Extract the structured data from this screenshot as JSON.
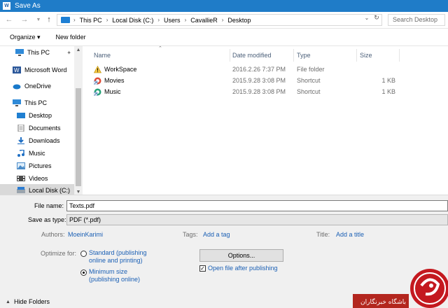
{
  "window": {
    "title": "Save As",
    "app_icon_glyph": "W"
  },
  "address": {
    "crumbs": [
      "This PC",
      "Local Disk (C:)",
      "Users",
      "CavallieR",
      "Desktop"
    ],
    "search_placeholder": "Search Desktop"
  },
  "toolbar": {
    "organize_label": "Organize ▾",
    "new_folder_label": "New folder"
  },
  "sidebar": {
    "items": [
      {
        "label": "This PC",
        "icon": "monitor-icon"
      },
      {
        "label": "Microsoft Word",
        "icon": "word-icon"
      },
      {
        "label": "OneDrive",
        "icon": "cloud-icon"
      },
      {
        "label": "This PC",
        "icon": "monitor-icon"
      },
      {
        "label": "Desktop",
        "icon": "desktop-icon"
      },
      {
        "label": "Documents",
        "icon": "documents-icon"
      },
      {
        "label": "Downloads",
        "icon": "download-icon"
      },
      {
        "label": "Music",
        "icon": "music-icon"
      },
      {
        "label": "Pictures",
        "icon": "pictures-icon"
      },
      {
        "label": "Videos",
        "icon": "videos-icon"
      },
      {
        "label": "Local Disk (C:)",
        "icon": "disk-icon"
      }
    ]
  },
  "files": {
    "columns": {
      "name": "Name",
      "date": "Date modified",
      "type": "Type",
      "size": "Size"
    },
    "rows": [
      {
        "name": "WorkSpace",
        "date": "2016.2.26 7:37 PM",
        "type": "File folder",
        "size": "",
        "icon": "warning-icon"
      },
      {
        "name": "Movies",
        "date": "2015.9.28 3:08 PM",
        "type": "Shortcut",
        "size": "1 KB",
        "icon": "shortcut-icon"
      },
      {
        "name": "Music",
        "date": "2015.9.28 3:08 PM",
        "type": "Shortcut",
        "size": "1 KB",
        "icon": "shortcut-icon"
      }
    ]
  },
  "form": {
    "file_name_label": "File name:",
    "file_name_value": "Texts.pdf",
    "save_type_label": "Save as type:",
    "save_type_value": "PDF (*.pdf)",
    "authors_label": "Authors:",
    "authors_value": "MoeinKarimi",
    "tags_label": "Tags:",
    "tags_value": "Add a tag",
    "title_label": "Title:",
    "title_value": "Add a title",
    "optimize_label": "Optimize for:",
    "opt_standard_line1": "Standard (publishing",
    "opt_standard_line2": "online and printing)",
    "opt_min_line1": "Minimum size",
    "opt_min_line2": "(publishing online)",
    "options_button": "Options...",
    "open_after_label": "Open file after publishing",
    "hide_folders_label": "Hide Folders"
  },
  "watermark": {
    "text": "باشگاه خبرنگاران"
  }
}
